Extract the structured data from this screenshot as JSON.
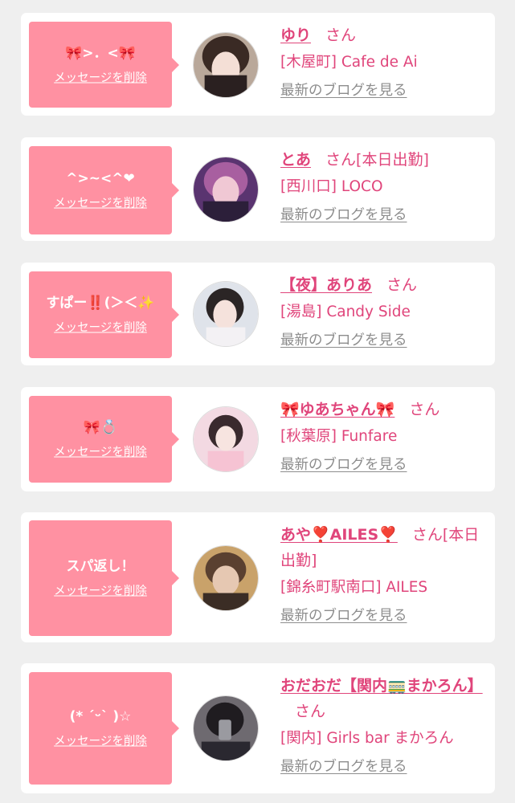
{
  "delete_label": "メッセージを削除",
  "blog_label": "最新のブログを見る",
  "honorific": "さん",
  "colors": {
    "bubble": "#ff91a2",
    "name": "#e0457b",
    "link_gray": "#8d8d8d",
    "card": "#ffffff",
    "background": "#efefef"
  },
  "cards": [
    {
      "message": "🎀>．<🎀",
      "name": "ゆり",
      "attendance": "",
      "shop": "[木屋町] Cafe de Ai"
    },
    {
      "message": "^>~<^❤",
      "name": "とあ",
      "attendance": "[本日出勤]",
      "shop": "[西川口] LOCO"
    },
    {
      "message": "すぱー‼️(＞＜✨",
      "name": "【夜】ありあ",
      "attendance": "",
      "shop": "[湯島] Candy Side"
    },
    {
      "message": "🎀💍",
      "name": "🎀ゆあちゃん🎀",
      "attendance": "",
      "shop": "[秋葉原] Funfare"
    },
    {
      "message": "スパ返し！",
      "name": "あや❣️AILES❣️",
      "attendance": "[本日出勤]",
      "shop": "[錦糸町駅南口] AILES"
    },
    {
      "message": "(* ˊᵕˋ )☆",
      "name": "おだおだ【関内🚃まかろん】",
      "attendance": "",
      "shop": "[関内] Girls bar まかろん"
    }
  ]
}
